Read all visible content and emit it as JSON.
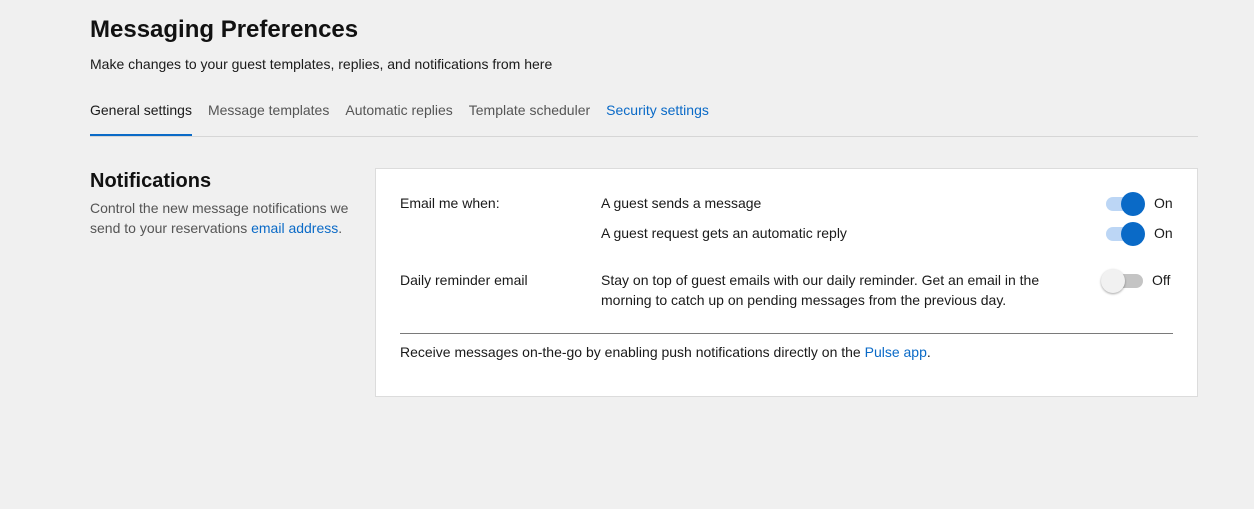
{
  "header": {
    "title": "Messaging Preferences",
    "subtitle": "Make changes to your guest templates, replies, and notifications from here"
  },
  "tabs": [
    {
      "label": "General settings",
      "active": true
    },
    {
      "label": "Message templates",
      "active": false
    },
    {
      "label": "Automatic replies",
      "active": false
    },
    {
      "label": "Template scheduler",
      "active": false
    },
    {
      "label": "Security settings",
      "active": false
    }
  ],
  "notifications": {
    "title": "Notifications",
    "description_prefix": "Control the new message notifications we send to your reservations ",
    "description_link": "email address",
    "description_suffix": "."
  },
  "card": {
    "email_label": "Email me when:",
    "email_options": [
      {
        "text": "A guest sends a message",
        "state": "On",
        "enabled": true
      },
      {
        "text": "A guest request gets an automatic reply",
        "state": "On",
        "enabled": true
      }
    ],
    "daily_label": "Daily reminder email",
    "daily_desc": "Stay on top of guest emails with our daily reminder. Get an email in the morning to catch up on pending messages from the previous day.",
    "daily_state": "Off",
    "daily_enabled": false,
    "footer_prefix": "Receive messages on-the-go by enabling push notifications directly on the ",
    "footer_link": "Pulse app",
    "footer_suffix": "."
  },
  "colors": {
    "accent": "#0a6ac7",
    "background": "#f0f0f0",
    "card": "#ffffff"
  }
}
